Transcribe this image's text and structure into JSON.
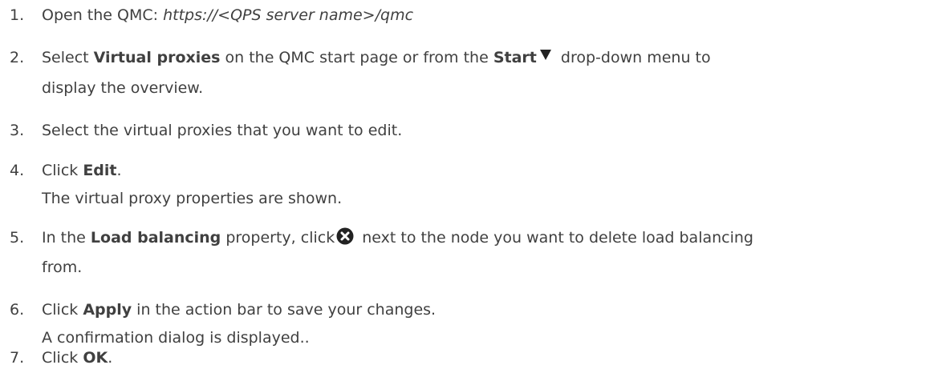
{
  "steps": [
    {
      "number": "1.",
      "lines": [
        {
          "prefix": "Open the QMC: ",
          "url": "https://<QPS server name>/qmc"
        }
      ]
    },
    {
      "number": "2.",
      "lines": [
        {
          "t1": "Select ",
          "b1": "Virtual proxies",
          "t2": " on the QMC start page or from the ",
          "b2": "Start",
          "t3": " drop-down menu to"
        },
        {
          "text": "display the overview."
        }
      ],
      "icon": "triangle-down-icon"
    },
    {
      "number": "3.",
      "lines": [
        {
          "text": "Select the virtual proxies that you want to edit."
        }
      ]
    },
    {
      "number": "4.",
      "lines": [
        {
          "t1": "Click ",
          "b1": "Edit",
          "t2": "."
        },
        {
          "text": "The virtual proxy properties are shown."
        }
      ]
    },
    {
      "number": "5.",
      "lines": [
        {
          "t1": "In the ",
          "b1": "Load balancing",
          "t2": " property, click",
          "t3": " next to the node you want to delete load balancing"
        },
        {
          "text": "from."
        }
      ],
      "icon": "delete-circle-icon"
    },
    {
      "number": "6.",
      "lines": [
        {
          "t1": "Click ",
          "b1": "Apply",
          "t2": " in the action bar to save your changes."
        },
        {
          "text": "A confirmation dialog is displayed.."
        }
      ]
    },
    {
      "number": "7.",
      "lines": [
        {
          "t1": "Click ",
          "b1": "OK",
          "t2": "."
        }
      ]
    }
  ]
}
